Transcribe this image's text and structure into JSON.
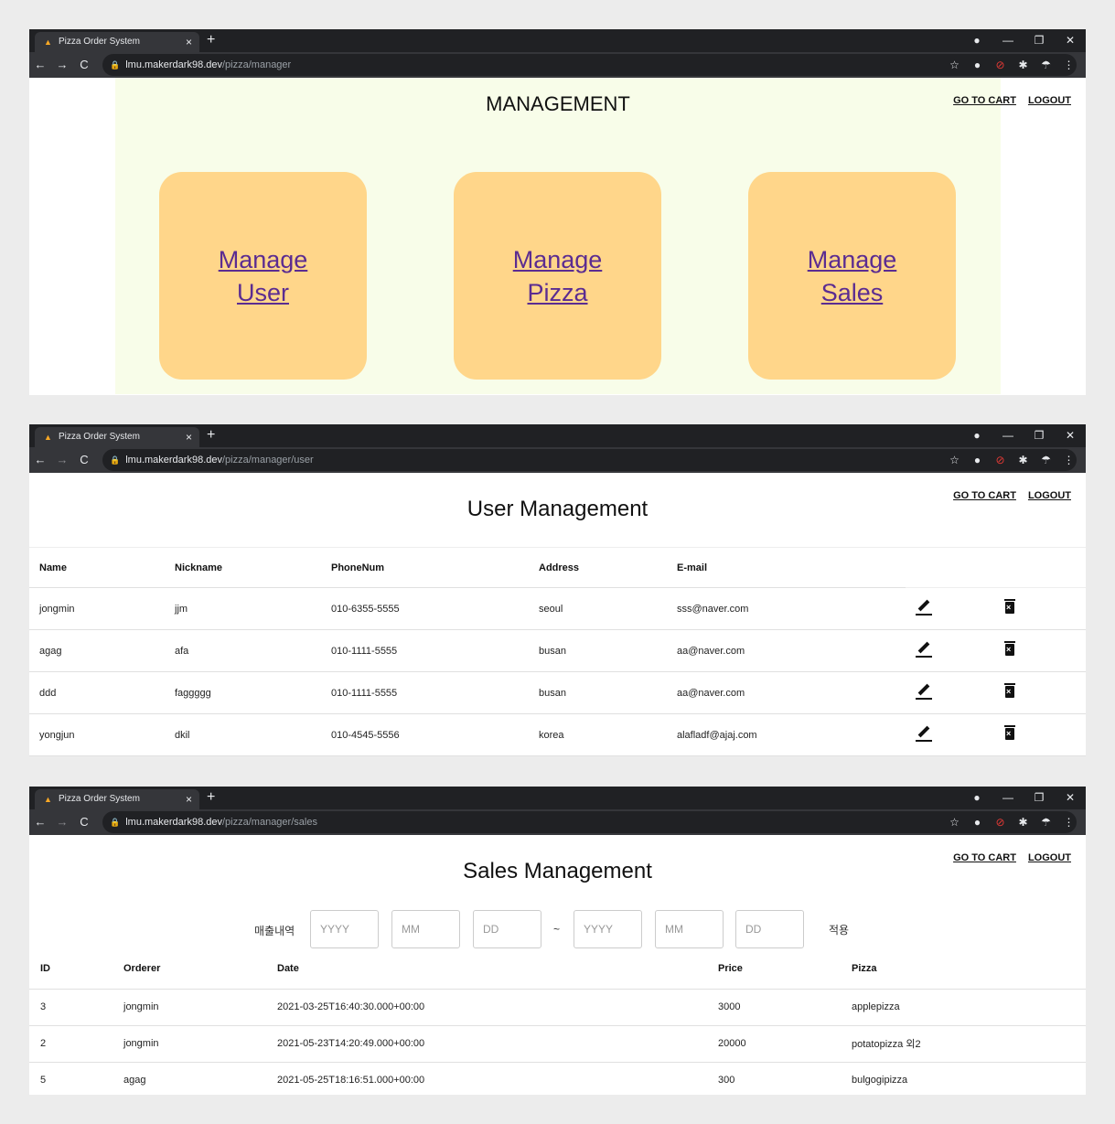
{
  "browser": {
    "tab_title": "Pizza Order System",
    "tab_close": "×",
    "new_tab": "+",
    "favicon": "▲",
    "window_controls": [
      "—",
      "❐",
      "✕"
    ],
    "nav": {
      "back": "←",
      "forward": "→",
      "reload": "C"
    },
    "lock": "🔒",
    "bookmark": "☆",
    "ext_icons": [
      "●",
      "⊘",
      "✱",
      "☂",
      "⋮"
    ],
    "domain": "lmu.makerdark98.dev"
  },
  "windows": [
    {
      "path": "/pizza/manager"
    },
    {
      "path": "/pizza/manager/user"
    },
    {
      "path": "/pizza/manager/sales"
    }
  ],
  "topnav": {
    "cart": "GO TO CART",
    "logout": "LOGOUT"
  },
  "management": {
    "title": "MANAGEMENT",
    "cards": [
      {
        "line1": "Manage",
        "line2": "User"
      },
      {
        "line1": "Manage",
        "line2": "Pizza"
      },
      {
        "line1": "Manage",
        "line2": "Sales"
      }
    ]
  },
  "users": {
    "title": "User Management",
    "headers": [
      "Name",
      "Nickname",
      "PhoneNum",
      "Address",
      "E-mail"
    ],
    "rows": [
      [
        "jongmin",
        "jjm",
        "010-6355-5555",
        "seoul",
        "sss@naver.com"
      ],
      [
        "agag",
        "afa",
        "010-1111-5555",
        "busan",
        "aa@naver.com"
      ],
      [
        "ddd",
        "faggggg",
        "010-1111-5555",
        "busan",
        "aa@naver.com"
      ],
      [
        "yongjun",
        "dkil",
        "010-4545-5556",
        "korea",
        "alafladf@ajaj.com"
      ]
    ]
  },
  "sales": {
    "title": "Sales Management",
    "filter": {
      "label": "매출내역",
      "from": [
        "YYYY",
        "MM",
        "DD"
      ],
      "to": [
        "YYYY",
        "MM",
        "DD"
      ],
      "tilde": "~",
      "apply": "적용"
    },
    "headers": [
      "ID",
      "Orderer",
      "Date",
      "Price",
      "Pizza"
    ],
    "rows": [
      [
        "3",
        "jongmin",
        "2021-03-25T16:40:30.000+00:00",
        "3000",
        "applepizza"
      ],
      [
        "2",
        "jongmin",
        "2021-05-23T14:20:49.000+00:00",
        "20000",
        "potatopizza 외2"
      ],
      [
        "5",
        "agag",
        "2021-05-25T18:16:51.000+00:00",
        "300",
        "bulgogipizza"
      ]
    ]
  }
}
